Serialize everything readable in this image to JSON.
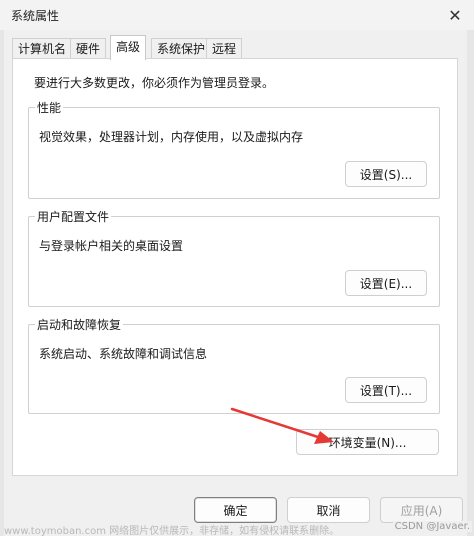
{
  "window": {
    "title": "系统属性",
    "close_glyph": "✕"
  },
  "tabs": [
    {
      "label": "计算机名",
      "active": false
    },
    {
      "label": "硬件",
      "active": false
    },
    {
      "label": "高级",
      "active": true
    },
    {
      "label": "系统保护",
      "active": false
    },
    {
      "label": "远程",
      "active": false
    }
  ],
  "notice": "要进行大多数更改，你必须作为管理员登录。",
  "performance": {
    "title": "性能",
    "description": "视觉效果，处理器计划，内存使用，以及虚拟内存",
    "button": "设置(S)..."
  },
  "user_profiles": {
    "title": "用户配置文件",
    "description": "与登录帐户相关的桌面设置",
    "button": "设置(E)..."
  },
  "startup_recovery": {
    "title": "启动和故障恢复",
    "description": "系统启动、系统故障和调试信息",
    "button": "设置(T)..."
  },
  "env_button": "环境变量(N)...",
  "footer": {
    "ok": "确定",
    "cancel": "取消",
    "apply": "应用(A)"
  },
  "annotation": {
    "arrow_color": "#e53935"
  },
  "watermark": {
    "left": "www.toymoban.com 网络图片仅供展示，非存储，如有侵权请联系删除。",
    "right": "CSDN @Javaer."
  }
}
